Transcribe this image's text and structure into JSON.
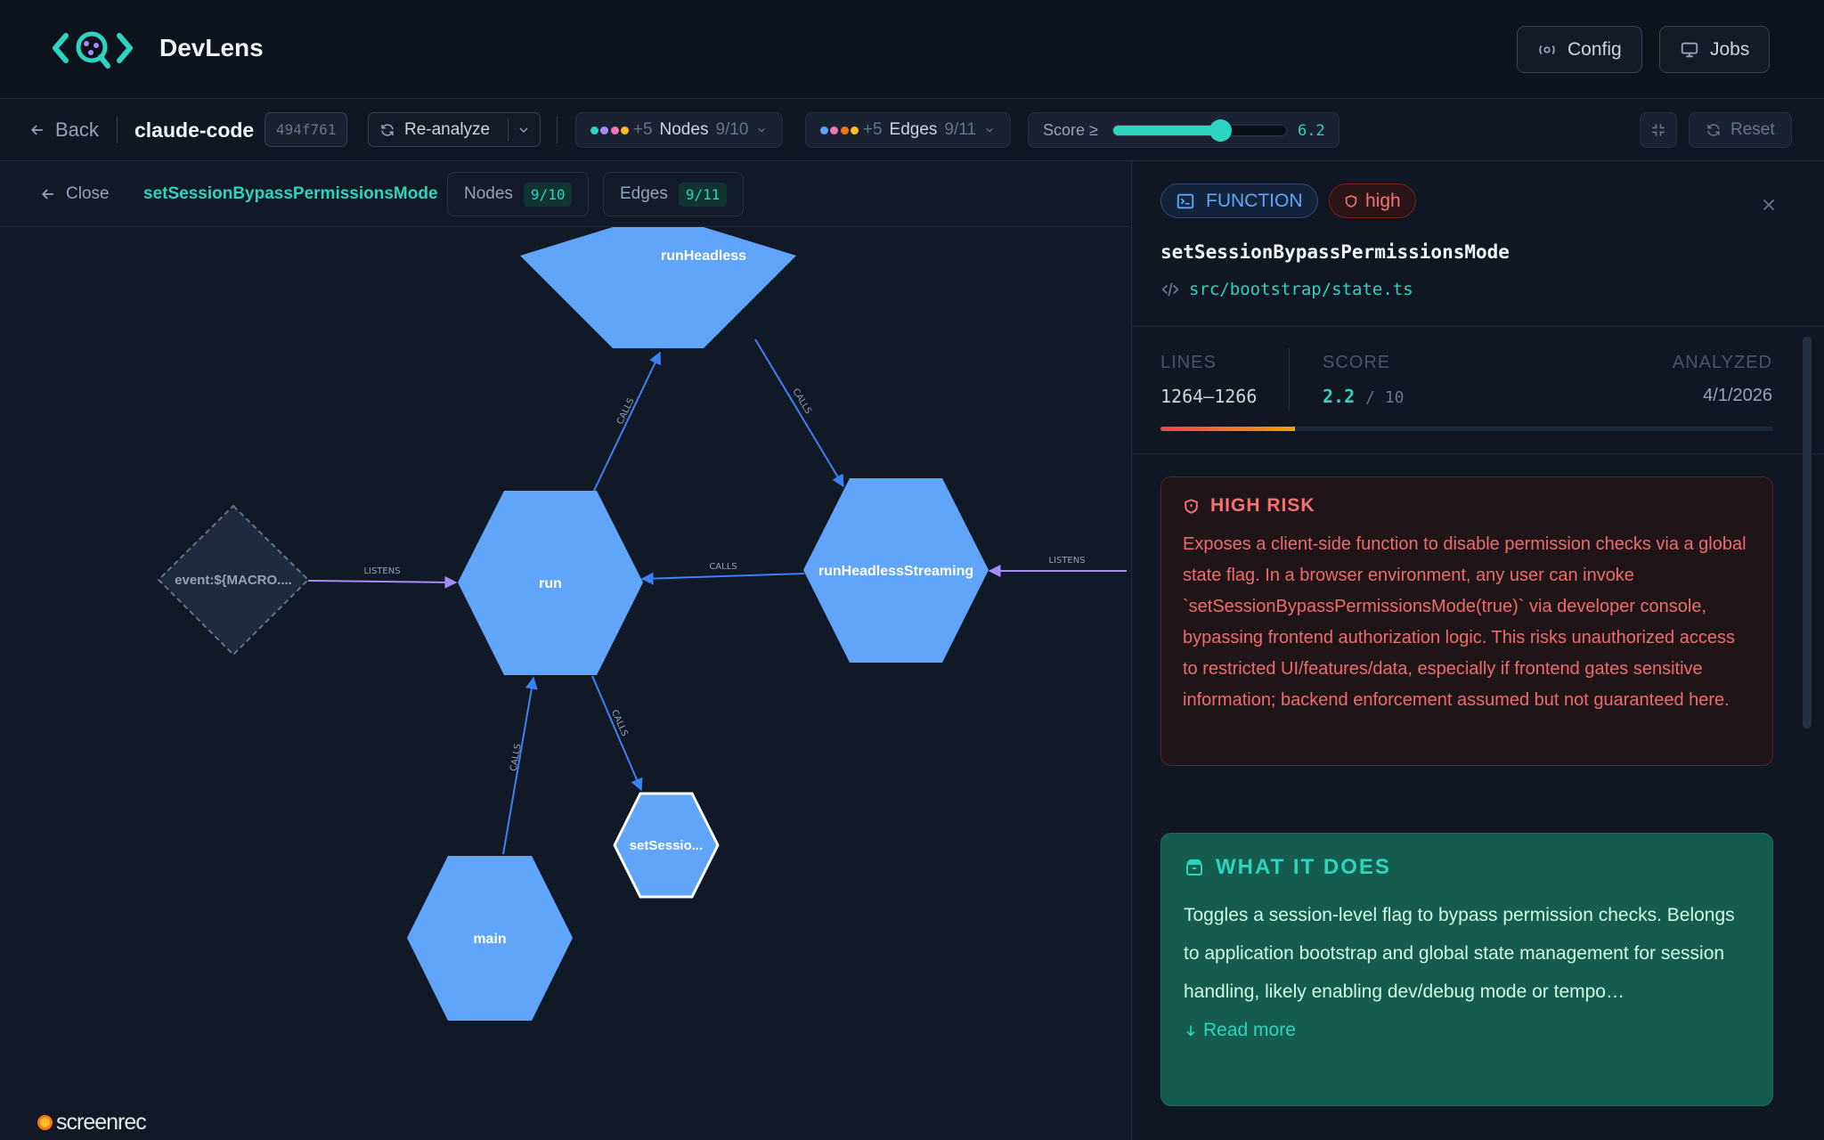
{
  "app": {
    "name": "DevLens"
  },
  "header": {
    "config_label": "Config",
    "jobs_label": "Jobs"
  },
  "toolbar": {
    "back_label": "Back",
    "project": "claude-code",
    "commit": "494f761",
    "reanalyze_label": "Re-analyze",
    "nodes_filter": {
      "extra": "+5",
      "label": "Nodes",
      "count": "9/10",
      "dot_colors": [
        "#2dd4bf",
        "#a78bfa",
        "#f472b6",
        "#fbbf24"
      ]
    },
    "edges_filter": {
      "extra": "+5",
      "label": "Edges",
      "count": "9/11",
      "dot_colors": [
        "#60a5fa",
        "#f472b6",
        "#f97316",
        "#fbbf24"
      ]
    },
    "score_label": "Score ≥",
    "score_value": "6.2",
    "score_fraction": 0.62,
    "reset_label": "Reset"
  },
  "graph": {
    "close_label": "Close",
    "focus_title": "setSessionBypassPermissionsMode",
    "nodes_pill": {
      "label": "Nodes",
      "count": "9/10"
    },
    "edges_pill": {
      "label": "Edges",
      "count": "9/11"
    },
    "nodes": [
      {
        "id": "runHeadless",
        "label": "runHeadless"
      },
      {
        "id": "runHeadlessStreaming",
        "label": "runHeadlessStreaming"
      },
      {
        "id": "run",
        "label": "run"
      },
      {
        "id": "event",
        "label": "event:${MACRO...."
      },
      {
        "id": "setSession",
        "label": "setSessio..."
      },
      {
        "id": "main",
        "label": "main"
      }
    ],
    "edges": [
      {
        "from": "run",
        "to": "runHeadless",
        "label": "CALLS"
      },
      {
        "from": "runHeadless",
        "to": "runHeadlessStreaming",
        "label": "CALLS"
      },
      {
        "from": "runHeadlessStreaming",
        "to": "run",
        "label": "CALLS"
      },
      {
        "from": "event",
        "to": "run",
        "label": "LISTENS"
      },
      {
        "from": "offscreen",
        "to": "runHeadlessStreaming",
        "label": "LISTENS"
      },
      {
        "from": "run",
        "to": "setSession",
        "label": "CALLS"
      },
      {
        "from": "main",
        "to": "run",
        "label": "CALLS"
      }
    ],
    "colors": {
      "node": "#60a5fa",
      "calls_edge": "#3b82f6",
      "listens_edge": "#a78bfa"
    }
  },
  "watermark": {
    "text": "screenrec"
  },
  "detail": {
    "kind": "FUNCTION",
    "severity": "high",
    "name": "setSessionBypassPermissionsMode",
    "path": "src/bootstrap/state.ts",
    "lines_label": "LINES",
    "lines_value": "1264–1266",
    "score_label": "SCORE",
    "score_value": "2.2",
    "score_max": "/ 10",
    "score_fraction": 0.22,
    "analyzed_label": "ANALYZED",
    "analyzed_value": "4/1/2026",
    "risk_title": "HIGH RISK",
    "risk_text": "Exposes a client-side function to disable permission checks via a global state flag. In a browser environment, any user can invoke `setSessionBypassPermissionsMode(true)` via developer console, bypassing frontend authorization logic. This risks unauthorized access to restricted UI/features/data, especially if frontend gates sensitive information; backend enforcement assumed but not guaranteed here.",
    "does_title": "WHAT IT DOES",
    "does_text": "Toggles a session-level flag to bypass permission checks. Belongs to application bootstrap and global state management for session handling, likely enabling dev/debug mode or tempo…",
    "read_more_label": "Read more"
  }
}
